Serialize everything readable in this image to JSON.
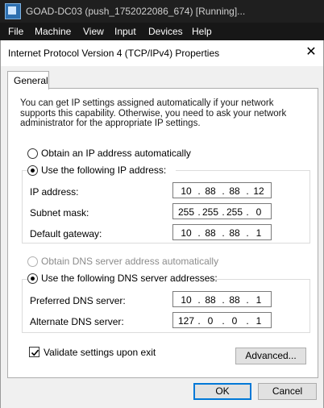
{
  "vm": {
    "title": "GOAD-DC03 (push_1752022086_674) [Running]...",
    "menu": [
      "File",
      "Machine",
      "View",
      "Input",
      "Devices",
      "Help"
    ]
  },
  "dialog": {
    "title": "Internet Protocol Version 4 (TCP/IPv4) Properties",
    "close_glyph": "✕",
    "tab_general": "General",
    "intro": "You can get IP settings assigned automatically if your network supports this capability. Otherwise, you need to ask your network administrator for the appropriate IP settings.",
    "obtain_ip_auto": "Obtain an IP address automatically",
    "use_following_ip": "Use the following IP address:",
    "ip_address_label": "IP address:",
    "ip_address": [
      "10",
      "88",
      "88",
      "12"
    ],
    "subnet_mask_label": "Subnet mask:",
    "subnet_mask": [
      "255",
      "255",
      "255",
      "0"
    ],
    "default_gateway_label": "Default gateway:",
    "default_gateway": [
      "10",
      "88",
      "88",
      "1"
    ],
    "obtain_dns_auto": "Obtain DNS server address automatically",
    "use_following_dns": "Use the following DNS server addresses:",
    "preferred_dns_label": "Preferred DNS server:",
    "preferred_dns": [
      "10",
      "88",
      "88",
      "1"
    ],
    "alternate_dns_label": "Alternate DNS server:",
    "alternate_dns": [
      "127",
      "0",
      "0",
      "1"
    ],
    "validate_label": "Validate settings upon exit",
    "validate_checked": true,
    "advanced_button": "Advanced...",
    "ok_button": "OK",
    "cancel_button": "Cancel",
    "ip_mode": "manual",
    "dns_mode": "manual"
  }
}
